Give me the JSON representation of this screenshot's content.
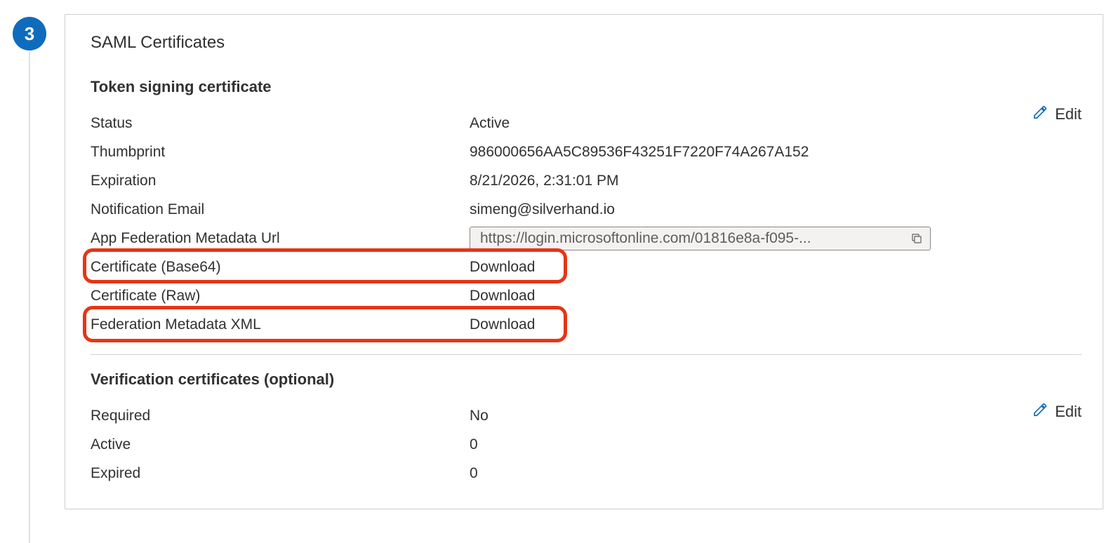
{
  "step_number": "3",
  "card_title": "SAML Certificates",
  "edit_label": "Edit",
  "sections": {
    "token_signing": {
      "title": "Token signing certificate",
      "rows": {
        "status_label": "Status",
        "status_value": "Active",
        "thumbprint_label": "Thumbprint",
        "thumbprint_value": "986000656AA5C89536F43251F7220F74A267A152",
        "expiration_label": "Expiration",
        "expiration_value": "8/21/2026, 2:31:01 PM",
        "notification_email_label": "Notification Email",
        "notification_email_value": "simeng@silverhand.io",
        "metadata_url_label": "App Federation Metadata Url",
        "metadata_url_value": "https://login.microsoftonline.com/01816e8a-f095-...",
        "cert_base64_label": "Certificate (Base64)",
        "cert_base64_link": "Download",
        "cert_raw_label": "Certificate (Raw)",
        "cert_raw_link": "Download",
        "fed_metadata_xml_label": "Federation Metadata XML",
        "fed_metadata_xml_link": "Download"
      }
    },
    "verification": {
      "title": "Verification certificates (optional)",
      "rows": {
        "required_label": "Required",
        "required_value": "No",
        "active_label": "Active",
        "active_value": "0",
        "expired_label": "Expired",
        "expired_value": "0"
      }
    }
  }
}
